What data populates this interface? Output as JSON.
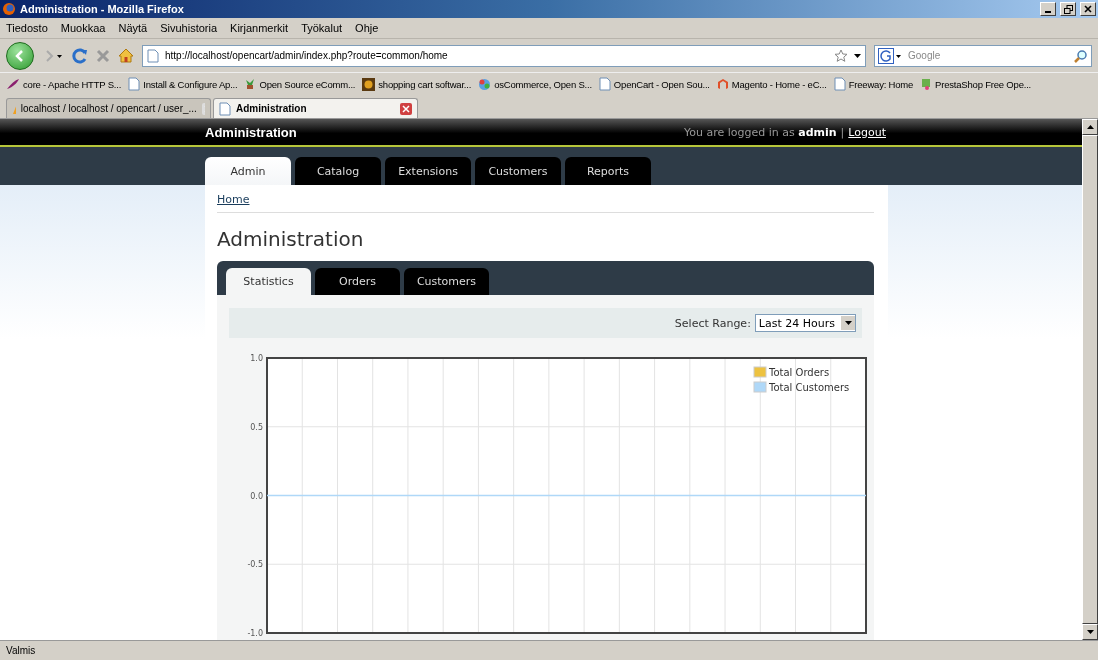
{
  "window": {
    "title": "Administration - Mozilla Firefox"
  },
  "menu": [
    "Tiedosto",
    "Muokkaa",
    "Näytä",
    "Sivuhistoria",
    "Kirjanmerkit",
    "Työkalut",
    "Ohje"
  ],
  "address": {
    "value": "http://localhost/opencart/admin/index.php?route=common/home"
  },
  "search": {
    "placeholder": "Google"
  },
  "bookmarks": [
    {
      "label": "core - Apache HTTP S...",
      "kind": "feather"
    },
    {
      "label": "Install & Configure Ap...",
      "kind": "page"
    },
    {
      "label": "Open Source eComm...",
      "kind": "plant"
    },
    {
      "label": "shopping cart softwar...",
      "kind": "square"
    },
    {
      "label": "osCommerce, Open S...",
      "kind": "globe"
    },
    {
      "label": "OpenCart - Open Sou...",
      "kind": "page"
    },
    {
      "label": "Magento - Home - eC...",
      "kind": "magento"
    },
    {
      "label": "Freeway: Home",
      "kind": "page"
    },
    {
      "label": "PrestaShop Free Ope...",
      "kind": "flag"
    }
  ],
  "browser_tabs": [
    {
      "label": "localhost / localhost / opencart / user_...",
      "selected": false
    },
    {
      "label": "Administration",
      "selected": true
    }
  ],
  "page": {
    "header": {
      "title": "Administration",
      "login_text": "You are logged in as **admin**",
      "separator": "|",
      "logout": "Logout"
    },
    "nav_tabs": [
      {
        "label": "Admin",
        "selected": true
      },
      {
        "label": "Catalog",
        "selected": false
      },
      {
        "label": "Extensions",
        "selected": false
      },
      {
        "label": "Customers",
        "selected": false
      },
      {
        "label": "Reports",
        "selected": false
      }
    ],
    "breadcrumb": "Home",
    "heading": "Administration",
    "section_tabs": [
      {
        "label": "Statistics",
        "selected": true
      },
      {
        "label": "Orders",
        "selected": false
      },
      {
        "label": "Customers",
        "selected": false
      }
    ],
    "range": {
      "label": "Select Range:",
      "value": "Last 24 Hours"
    },
    "chart_data": {
      "type": "line",
      "grid": true,
      "legend": true,
      "ylim": [
        -1,
        1
      ],
      "yticks": [
        {
          "value": 1,
          "label": "1.0"
        },
        {
          "value": 0.5,
          "label": "0.5"
        },
        {
          "value": 0,
          "label": "0.0"
        },
        {
          "value": -0.5,
          "label": "-0.5"
        },
        {
          "value": -1,
          "label": "-1.0"
        }
      ],
      "series": [
        {
          "name": "Total Orders",
          "color": "#edc240",
          "values": [
            null,
            null,
            null,
            null,
            null,
            null,
            null,
            null,
            null,
            null,
            null,
            null,
            null,
            null,
            null,
            null,
            null,
            null
          ]
        },
        {
          "name": "Total Customers",
          "color": "#afd8f8",
          "values": [
            0,
            0,
            0,
            0,
            0,
            0,
            0,
            0,
            0,
            0,
            0,
            0,
            0,
            0,
            0,
            0,
            0,
            0
          ]
        }
      ]
    }
  },
  "status_bar": {
    "text": "Valmis"
  }
}
